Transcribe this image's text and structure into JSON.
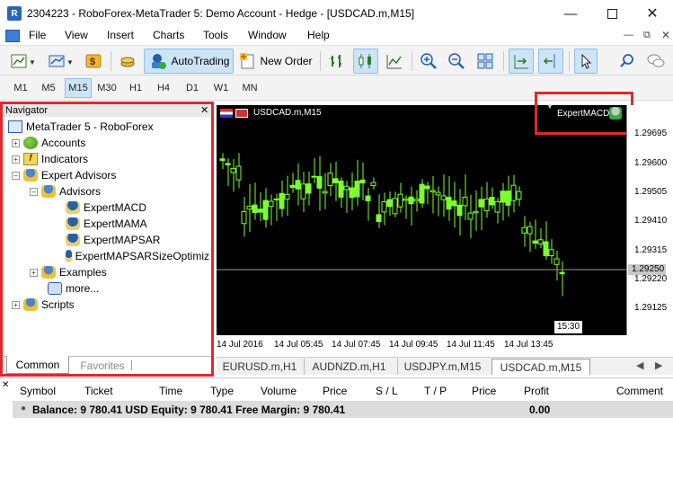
{
  "window": {
    "title": "2304223 - RoboForex-MetaTrader 5: Demo Account - Hedge - [USDCAD.m,M15]"
  },
  "menu": [
    "File",
    "View",
    "Insert",
    "Charts",
    "Tools",
    "Window",
    "Help"
  ],
  "toolbar": {
    "autotrading_label": "AutoTrading",
    "new_order_label": "New Order"
  },
  "timeframes": [
    "M1",
    "M5",
    "M15",
    "M30",
    "H1",
    "H4",
    "D1",
    "W1",
    "MN"
  ],
  "active_timeframe": "M15",
  "navigator": {
    "title": "Navigator",
    "root": "MetaTrader 5 - RoboForex",
    "items": [
      {
        "label": "Accounts"
      },
      {
        "label": "Indicators"
      },
      {
        "label": "Expert Advisors"
      },
      {
        "label": "Advisors"
      },
      {
        "label": "ExpertMACD"
      },
      {
        "label": "ExpertMAMA"
      },
      {
        "label": "ExpertMAPSAR"
      },
      {
        "label": "ExpertMAPSARSizeOptimiz"
      },
      {
        "label": "Examples"
      },
      {
        "label": "more..."
      },
      {
        "label": "Scripts"
      }
    ],
    "tabs": [
      "Common",
      "Favorites"
    ]
  },
  "chart": {
    "symbol_label": "USDCAD.m,M15",
    "expert_label": "ExpertMACD",
    "price_ticks": [
      "1.29695",
      "1.29600",
      "1.29505",
      "1.29410",
      "1.29315",
      "1.29220",
      "1.29125"
    ],
    "current_price": "1.29250",
    "time_ticks": [
      "14 Jul 2016",
      "14 Jul 05:45",
      "14 Jul 07:45",
      "14 Jul 09:45",
      "14 Jul 11:45",
      "14 Jul 13:45"
    ],
    "time_marker": "15:30",
    "colors": {
      "bg": "#000000",
      "candle": "#7cff2e",
      "axis_text": "#000000"
    }
  },
  "chart_tabs": [
    "EURUSD.m,H1",
    "AUDNZD.m,H1",
    "USDJPY.m,M15",
    "USDCAD.m,M15"
  ],
  "active_chart_tab": "USDCAD.m,M15",
  "terminal": {
    "columns": [
      "Symbol",
      "Ticket",
      "Time",
      "Type",
      "Volume",
      "Price",
      "S / L",
      "T / P",
      "Price",
      "Profit",
      "Comment"
    ],
    "balance_text": "Balance: 9 780.41 USD  Equity: 9 780.41  Free Margin: 9 780.41",
    "profit": "0.00"
  }
}
